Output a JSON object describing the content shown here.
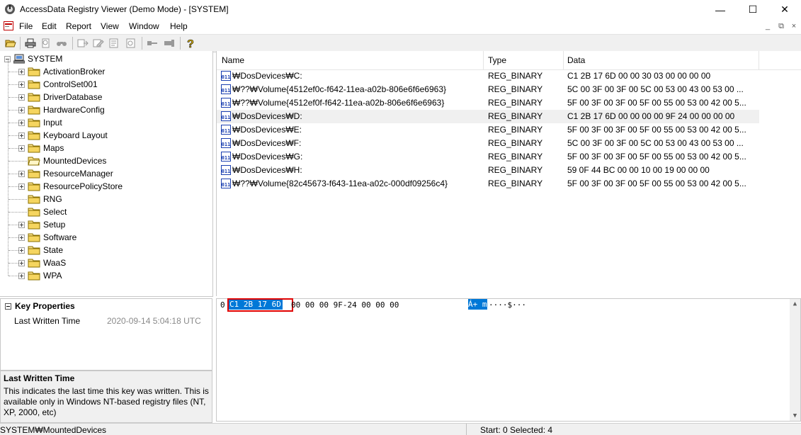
{
  "window": {
    "title": "AccessData Registry Viewer (Demo Mode) - [SYSTEM]",
    "minimize_glyph": "—",
    "maximize_glyph": "☐",
    "close_glyph": "✕"
  },
  "menu": {
    "items": [
      "File",
      "Edit",
      "Report",
      "View",
      "Window",
      "Help"
    ]
  },
  "mdi_controls": [
    "_",
    "⧉",
    "×"
  ],
  "tree": {
    "root": "SYSTEM",
    "children": [
      {
        "label": "ActivationBroker",
        "expandable": true
      },
      {
        "label": "ControlSet001",
        "expandable": true
      },
      {
        "label": "DriverDatabase",
        "expandable": true
      },
      {
        "label": "HardwareConfig",
        "expandable": true
      },
      {
        "label": "Input",
        "expandable": true
      },
      {
        "label": "Keyboard Layout",
        "expandable": true
      },
      {
        "label": "Maps",
        "expandable": true
      },
      {
        "label": "MountedDevices",
        "expandable": false,
        "open": true
      },
      {
        "label": "ResourceManager",
        "expandable": true
      },
      {
        "label": "ResourcePolicyStore",
        "expandable": true
      },
      {
        "label": "RNG",
        "expandable": false
      },
      {
        "label": "Select",
        "expandable": false
      },
      {
        "label": "Setup",
        "expandable": true
      },
      {
        "label": "Software",
        "expandable": true
      },
      {
        "label": "State",
        "expandable": true
      },
      {
        "label": "WaaS",
        "expandable": true
      },
      {
        "label": "WPA",
        "expandable": true
      }
    ]
  },
  "list": {
    "columns": [
      "Name",
      "Type",
      "Data"
    ],
    "rows": [
      {
        "name": "₩DosDevices₩C:",
        "type": "REG_BINARY",
        "data": "C1 2B 17 6D 00 00 30 03 00 00 00 00"
      },
      {
        "name": "₩??₩Volume{4512ef0c-f642-11ea-a02b-806e6f6e6963}",
        "type": "REG_BINARY",
        "data": "5C 00 3F 00 3F 00 5C 00 53 00 43 00 53 00 ..."
      },
      {
        "name": "₩??₩Volume{4512ef0f-f642-11ea-a02b-806e6f6e6963}",
        "type": "REG_BINARY",
        "data": "5F 00 3F 00 3F 00 5F 00 55 00 53 00 42 00 5..."
      },
      {
        "name": "₩DosDevices₩D:",
        "type": "REG_BINARY",
        "data": "C1 2B 17 6D 00 00 00 00 9F 24 00 00 00 00",
        "selected": true
      },
      {
        "name": "₩DosDevices₩E:",
        "type": "REG_BINARY",
        "data": "5F 00 3F 00 3F 00 5F 00 55 00 53 00 42 00 5..."
      },
      {
        "name": "₩DosDevices₩F:",
        "type": "REG_BINARY",
        "data": "5C 00 3F 00 3F 00 5C 00 53 00 43 00 53 00 ..."
      },
      {
        "name": "₩DosDevices₩G:",
        "type": "REG_BINARY",
        "data": "5F 00 3F 00 3F 00 5F 00 55 00 53 00 42 00 5..."
      },
      {
        "name": "₩DosDevices₩H:",
        "type": "REG_BINARY",
        "data": "59 0F 44 BC 00 00 10 00 19 00 00 00"
      },
      {
        "name": "₩??₩Volume{82c45673-f643-11ea-a02c-000df09256c4}",
        "type": "REG_BINARY",
        "data": "5F 00 3F 00 3F 00 5F 00 55 00 53 00 42 00 5..."
      }
    ]
  },
  "key_properties": {
    "header": "Key Properties",
    "prop_name": "Last Written Time",
    "prop_value": "2020-09-14 5:04:18 UTC"
  },
  "description": {
    "title": "Last Written Time",
    "text": "This indicates the last time this key was written. This is available only in Windows NT-based registry files (NT, XP, 2000, etc)"
  },
  "hex": {
    "offset": "0",
    "selected_bytes": "C1 2B 17 6D",
    "remaining_bytes": "00 00 00 9F-24 00 00 00",
    "ascii_selected": "Á+ m",
    "ascii_rest": "····$···",
    "selection_color": "#0078d7",
    "highlight_border": "#e00000"
  },
  "status": {
    "path": "SYSTEM₩MountedDevices",
    "selection": "Start: 0 Selected: 4"
  }
}
